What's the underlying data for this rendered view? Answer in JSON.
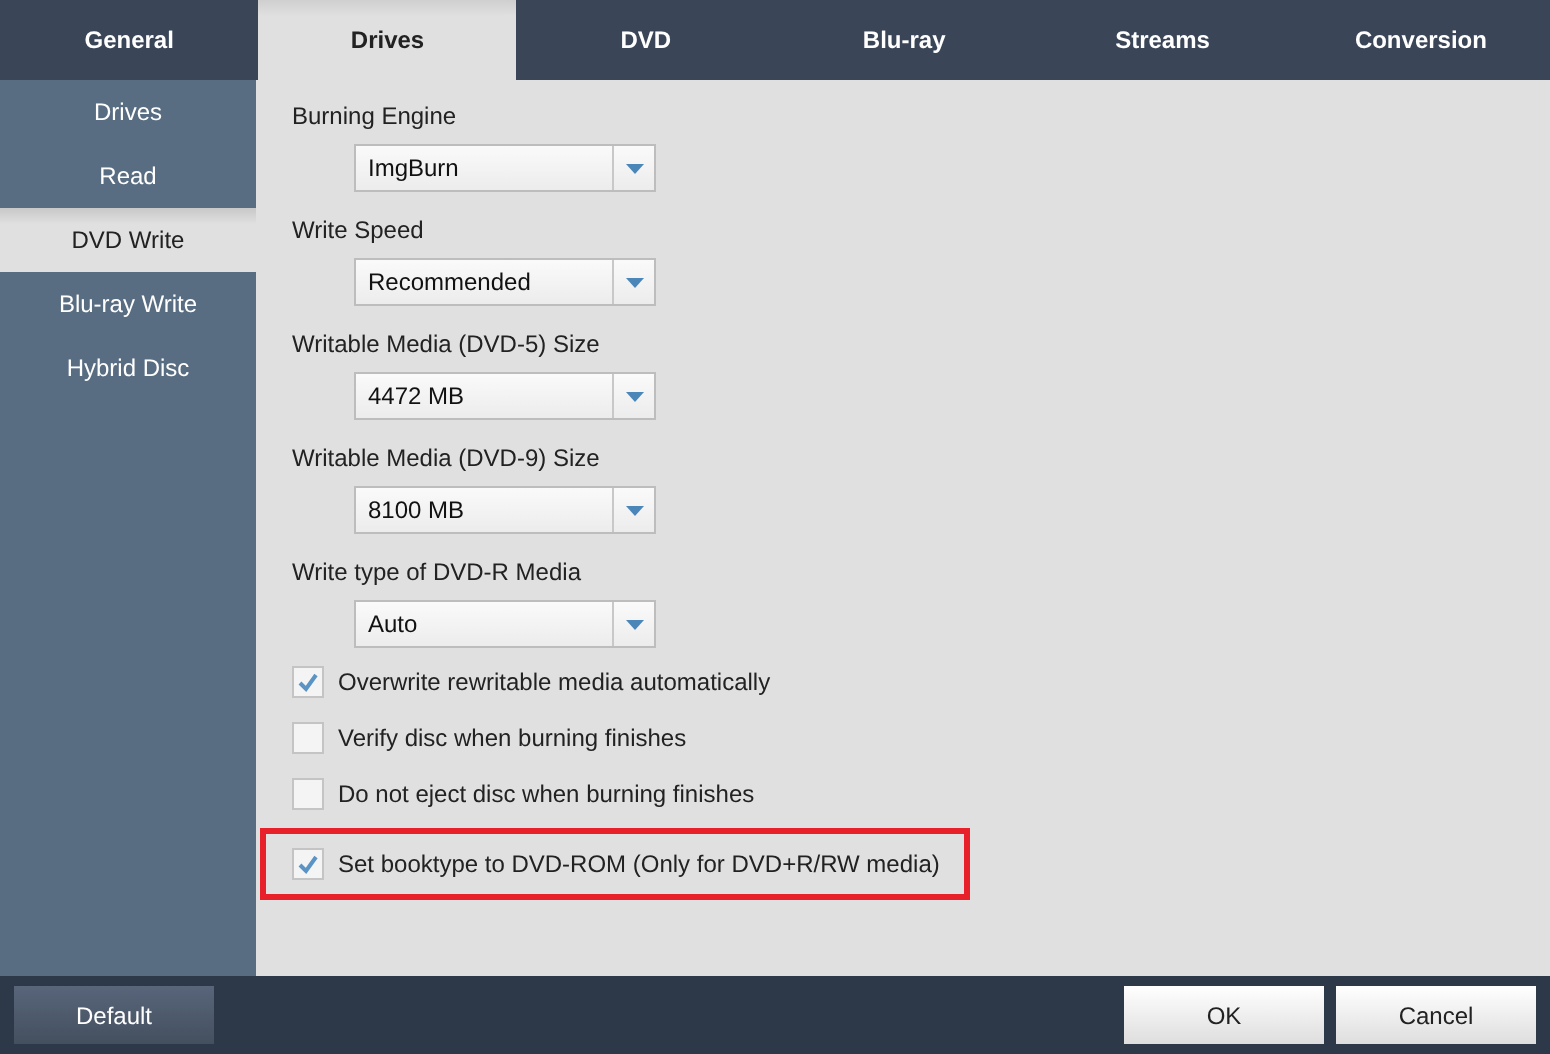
{
  "tabs": [
    {
      "label": "General",
      "selected": false
    },
    {
      "label": "Drives",
      "selected": true
    },
    {
      "label": "DVD",
      "selected": false
    },
    {
      "label": "Blu-ray",
      "selected": false
    },
    {
      "label": "Streams",
      "selected": false
    },
    {
      "label": "Conversion",
      "selected": false
    }
  ],
  "sidebar": {
    "items": [
      {
        "label": "Drives",
        "selected": false
      },
      {
        "label": "Read",
        "selected": false
      },
      {
        "label": "DVD Write",
        "selected": true
      },
      {
        "label": "Blu-ray Write",
        "selected": false
      },
      {
        "label": "Hybrid Disc",
        "selected": false
      }
    ]
  },
  "settings": [
    {
      "label": "Burning Engine",
      "value": "ImgBurn"
    },
    {
      "label": "Write Speed",
      "value": "Recommended"
    },
    {
      "label": "Writable Media (DVD-5) Size",
      "value": "4472 MB"
    },
    {
      "label": "Writable Media (DVD-9) Size",
      "value": "8100 MB"
    },
    {
      "label": "Write type of DVD-R Media",
      "value": "Auto"
    }
  ],
  "options": [
    {
      "label": "Overwrite rewritable media automatically",
      "checked": true,
      "highlighted": false
    },
    {
      "label": "Verify disc when burning finishes",
      "checked": false,
      "highlighted": false
    },
    {
      "label": "Do not eject disc when burning finishes",
      "checked": false,
      "highlighted": false
    },
    {
      "label": "Set booktype to DVD-ROM (Only for DVD+R/RW media)",
      "checked": true,
      "highlighted": true
    }
  ],
  "footer": {
    "default_button": "Default",
    "buttons": [
      "OK",
      "Cancel"
    ]
  }
}
